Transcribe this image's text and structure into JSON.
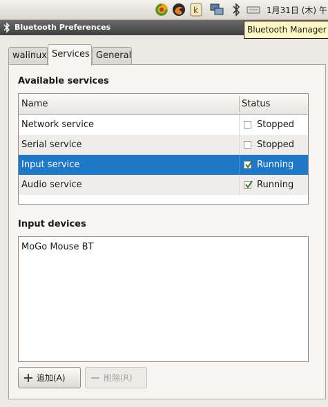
{
  "panel": {
    "clock": "1月31日 (木) 午"
  },
  "tooltip": {
    "text": "Bluetooth Manager"
  },
  "window": {
    "title": "Bluetooth Preferences"
  },
  "tabs": [
    {
      "label": "walinux"
    },
    {
      "label": "Services"
    },
    {
      "label": "General"
    }
  ],
  "services": {
    "section_title": "Available services",
    "columns": {
      "name": "Name",
      "status": "Status"
    },
    "rows": [
      {
        "name": "Network service",
        "status": "Stopped",
        "checked": false
      },
      {
        "name": "Serial service",
        "status": "Stopped",
        "checked": false
      },
      {
        "name": "Input service",
        "status": "Running",
        "checked": true
      },
      {
        "name": "Audio service",
        "status": "Running",
        "checked": true
      }
    ]
  },
  "devices": {
    "section_title": "Input devices",
    "items": [
      "MoGo Mouse BT"
    ]
  },
  "buttons": {
    "add_label": "追加(A)",
    "remove_label": "削除(R)"
  },
  "colors": {
    "selection": "#1f77c8",
    "tooltip_bg": "#fdf8c4"
  }
}
